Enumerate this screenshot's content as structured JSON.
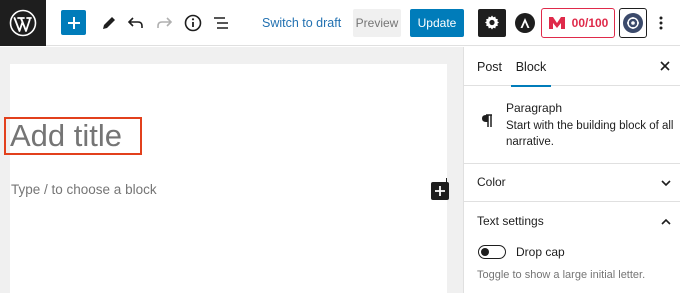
{
  "toolbar": {
    "wp_logo_icon": "wordpress-logo-icon",
    "add_block_icon": "plus-icon",
    "tools_icon": "pencil-icon",
    "undo_icon": "undo-icon",
    "redo_icon": "redo-icon",
    "details_icon": "info-icon",
    "list_view_icon": "list-view-icon",
    "switch_to_draft": "Switch to draft",
    "preview": "Preview",
    "update": "Update",
    "settings_icon": "gear-icon",
    "astra_icon": "astra-icon",
    "seo_icon": "aioseo-icon",
    "seo_score": "00/100",
    "avatar_icon": "user-avatar-icon",
    "more_icon": "more-vertical-icon"
  },
  "editor": {
    "title_placeholder": "Add title",
    "block_placeholder": "Type / to choose a block",
    "inserter_icon": "plus-icon"
  },
  "sidebar": {
    "tabs": [
      {
        "label": "Post",
        "active": false
      },
      {
        "label": "Block",
        "active": true
      }
    ],
    "close_icon": "close-icon",
    "block": {
      "icon": "paragraph-icon",
      "name": "Paragraph",
      "description": "Start with the building block of all narrative."
    },
    "panels": {
      "color": {
        "title": "Color",
        "state": "collapsed"
      },
      "text_settings": {
        "title": "Text settings",
        "state": "expanded",
        "drop_cap_label": "Drop cap",
        "drop_cap_enabled": false,
        "drop_cap_help": "Toggle to show a large initial letter."
      }
    }
  },
  "colors": {
    "accent": "#007cba",
    "highlight": "#e2401c",
    "seo_red": "#df2a4a",
    "dark": "#1e1e1e"
  }
}
